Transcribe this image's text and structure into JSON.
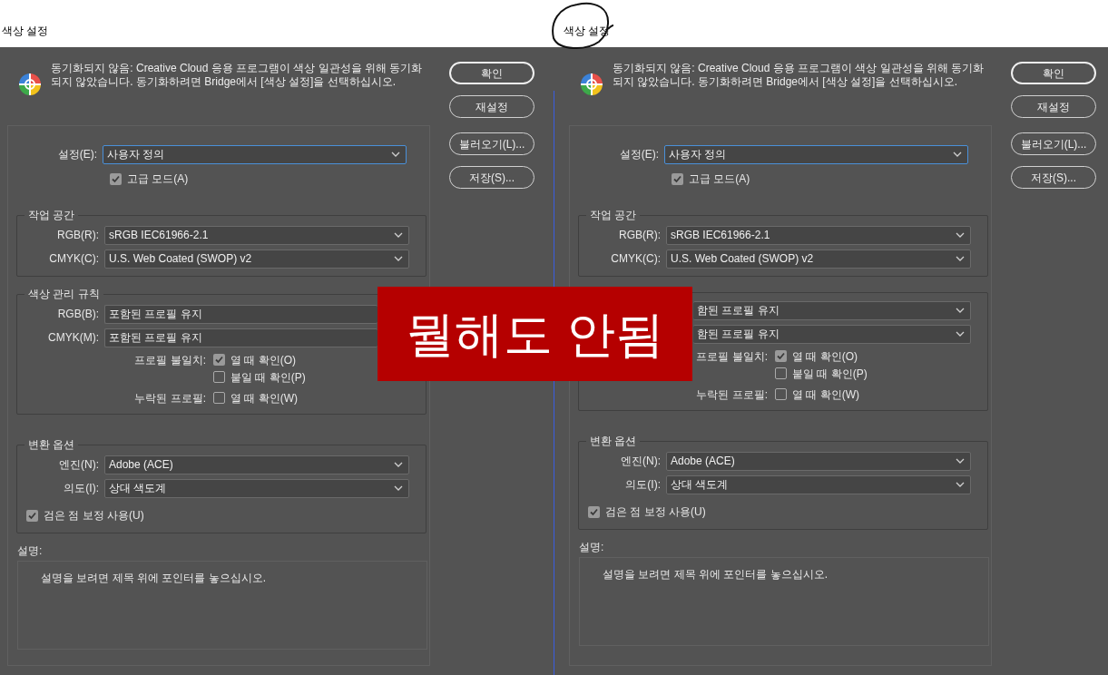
{
  "dialogs": [
    {
      "title": "색상 설정",
      "message": "동기화되지  않음: Creative  Cloud 응용 프로그램이 색상 일관성을 위해 동기화되지  않았습니다.  동기화하려면 Bridge에서 [색상 설정]을 선택하십시오.",
      "buttons": [
        {
          "label": "확인",
          "default": true
        },
        {
          "label": "재설정",
          "default": false
        },
        {
          "label": "불러오기(L)...",
          "default": false
        },
        {
          "label": "저장(S)...",
          "default": false
        }
      ],
      "preset": {
        "label": "설정(E):",
        "value": "사용자 정의",
        "focused": true
      },
      "advanced": {
        "label": "고급 모드(A)",
        "checked": true
      },
      "groups": [
        {
          "title": "작업 공간",
          "rows": [
            {
              "kind": "dropdown",
              "label": "RGB(R):",
              "value": "sRGB IEC61966-2.1"
            },
            {
              "kind": "dropdown",
              "label": "CMYK(C):",
              "value": "U.S. Web Coated (SWOP) v2"
            }
          ]
        },
        {
          "title": "색상 관리 규칙",
          "rows": [
            {
              "kind": "dropdown",
              "label": "RGB(B):",
              "value": "포함된 프로필 유지"
            },
            {
              "kind": "dropdown",
              "label": "CMYK(M):",
              "value": "포함된 프로필 유지"
            },
            {
              "kind": "check",
              "label": "프로필 불일치:",
              "text": "열 때 확인(O)",
              "checked": true
            },
            {
              "kind": "check",
              "text": "붙일 때 확인(P)",
              "checked": false
            },
            {
              "kind": "check",
              "label": "누락된 프로필:",
              "text": "열 때 확인(W)",
              "checked": false
            }
          ]
        },
        {
          "title": "변환 옵션",
          "rows": [
            {
              "kind": "dropdown",
              "label": "엔진(N):",
              "value": "Adobe (ACE)"
            },
            {
              "kind": "dropdown",
              "label": "의도(I):",
              "value": "상대 색도계"
            },
            {
              "kind": "wide_check",
              "text": "검은 점 보정 사용(U)",
              "checked": true
            }
          ]
        }
      ],
      "description": {
        "label": "설명:",
        "text": "설명을 보려면 제목 위에 포인터를 놓으십시오."
      }
    },
    {
      "title": "색상 설정",
      "message": "동기화되지  않음: Creative  Cloud 응용 프로그램이 색상 일관성을 위해 동기화되지  않았습니다.  동기화하려면 Bridge에서 [색상 설정]을 선택하십시오.",
      "buttons": [
        {
          "label": "확인",
          "default": true
        },
        {
          "label": "재설정",
          "default": false
        },
        {
          "label": "불러오기(L)...",
          "default": false
        },
        {
          "label": "저장(S)...",
          "default": false
        }
      ],
      "preset": {
        "label": "설정(E):",
        "value": "사용자 정의",
        "focused": true
      },
      "advanced": {
        "label": "고급 모드(A)",
        "checked": true
      },
      "groups": [
        {
          "title": "작업 공간",
          "rows": [
            {
              "kind": "dropdown",
              "label": "RGB(R):",
              "value": "sRGB IEC61966-2.1"
            },
            {
              "kind": "dropdown",
              "label": "CMYK(C):",
              "value": "U.S. Web Coated (SWOP) v2"
            }
          ]
        },
        {
          "rows": [
            {
              "kind": "dropdown",
              "value": "함된 프로필 유지"
            },
            {
              "kind": "dropdown",
              "value": "함된 프로필 유지"
            },
            {
              "kind": "check",
              "label": "프로필 불일치:",
              "text": "열 때 확인(O)",
              "checked": true
            },
            {
              "kind": "check",
              "text": "붙일 때 확인(P)",
              "checked": false
            },
            {
              "kind": "check",
              "label": "누락된 프로필:",
              "text": "열 때 확인(W)",
              "checked": false
            }
          ]
        },
        {
          "title": "변환 옵션",
          "rows": [
            {
              "kind": "dropdown",
              "label": "엔진(N):",
              "value": "Adobe (ACE)"
            },
            {
              "kind": "dropdown",
              "label": "의도(I):",
              "value": "상대 색도계"
            },
            {
              "kind": "wide_check",
              "text": "검은 점 보정 사용(U)",
              "checked": true
            }
          ]
        }
      ],
      "description": {
        "label": "설명:",
        "text": "설명을 보려면 제목 위에 포인터를 놓으십시오."
      }
    }
  ],
  "overlay": {
    "text": "뭘해도 안됨"
  }
}
